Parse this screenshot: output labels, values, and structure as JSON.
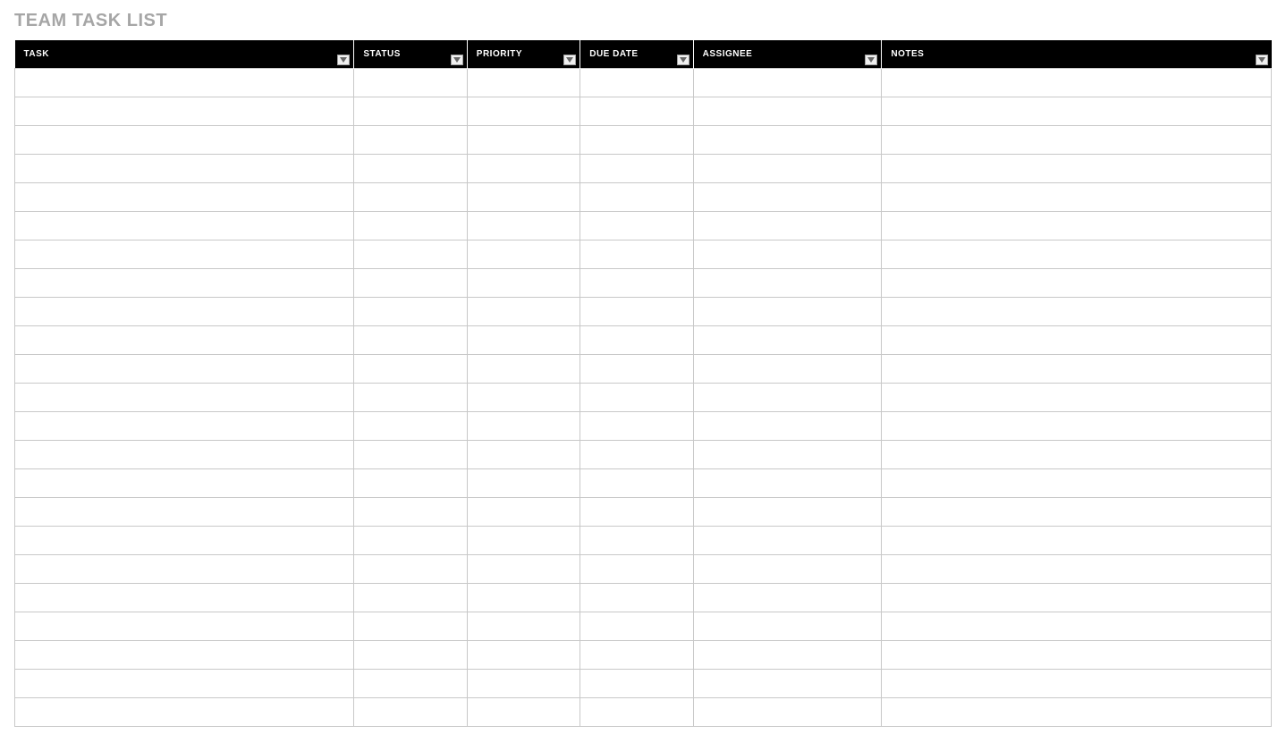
{
  "title": "TEAM TASK LIST",
  "columns": [
    {
      "label": "TASK",
      "key": "task"
    },
    {
      "label": "STATUS",
      "key": "status"
    },
    {
      "label": "PRIORITY",
      "key": "priority"
    },
    {
      "label": "DUE DATE",
      "key": "duedate"
    },
    {
      "label": "ASSIGNEE",
      "key": "assignee"
    },
    {
      "label": "NOTES",
      "key": "notes"
    }
  ],
  "rows": [
    {
      "task": "",
      "status": "",
      "priority": "",
      "duedate": "",
      "assignee": "",
      "notes": ""
    },
    {
      "task": "",
      "status": "",
      "priority": "",
      "duedate": "",
      "assignee": "",
      "notes": ""
    },
    {
      "task": "",
      "status": "",
      "priority": "",
      "duedate": "",
      "assignee": "",
      "notes": ""
    },
    {
      "task": "",
      "status": "",
      "priority": "",
      "duedate": "",
      "assignee": "",
      "notes": ""
    },
    {
      "task": "",
      "status": "",
      "priority": "",
      "duedate": "",
      "assignee": "",
      "notes": ""
    },
    {
      "task": "",
      "status": "",
      "priority": "",
      "duedate": "",
      "assignee": "",
      "notes": ""
    },
    {
      "task": "",
      "status": "",
      "priority": "",
      "duedate": "",
      "assignee": "",
      "notes": ""
    },
    {
      "task": "",
      "status": "",
      "priority": "",
      "duedate": "",
      "assignee": "",
      "notes": ""
    },
    {
      "task": "",
      "status": "",
      "priority": "",
      "duedate": "",
      "assignee": "",
      "notes": ""
    },
    {
      "task": "",
      "status": "",
      "priority": "",
      "duedate": "",
      "assignee": "",
      "notes": ""
    },
    {
      "task": "",
      "status": "",
      "priority": "",
      "duedate": "",
      "assignee": "",
      "notes": ""
    },
    {
      "task": "",
      "status": "",
      "priority": "",
      "duedate": "",
      "assignee": "",
      "notes": ""
    },
    {
      "task": "",
      "status": "",
      "priority": "",
      "duedate": "",
      "assignee": "",
      "notes": ""
    },
    {
      "task": "",
      "status": "",
      "priority": "",
      "duedate": "",
      "assignee": "",
      "notes": ""
    },
    {
      "task": "",
      "status": "",
      "priority": "",
      "duedate": "",
      "assignee": "",
      "notes": ""
    },
    {
      "task": "",
      "status": "",
      "priority": "",
      "duedate": "",
      "assignee": "",
      "notes": ""
    },
    {
      "task": "",
      "status": "",
      "priority": "",
      "duedate": "",
      "assignee": "",
      "notes": ""
    },
    {
      "task": "",
      "status": "",
      "priority": "",
      "duedate": "",
      "assignee": "",
      "notes": ""
    },
    {
      "task": "",
      "status": "",
      "priority": "",
      "duedate": "",
      "assignee": "",
      "notes": ""
    },
    {
      "task": "",
      "status": "",
      "priority": "",
      "duedate": "",
      "assignee": "",
      "notes": ""
    },
    {
      "task": "",
      "status": "",
      "priority": "",
      "duedate": "",
      "assignee": "",
      "notes": ""
    },
    {
      "task": "",
      "status": "",
      "priority": "",
      "duedate": "",
      "assignee": "",
      "notes": ""
    },
    {
      "task": "",
      "status": "",
      "priority": "",
      "duedate": "",
      "assignee": "",
      "notes": ""
    }
  ]
}
